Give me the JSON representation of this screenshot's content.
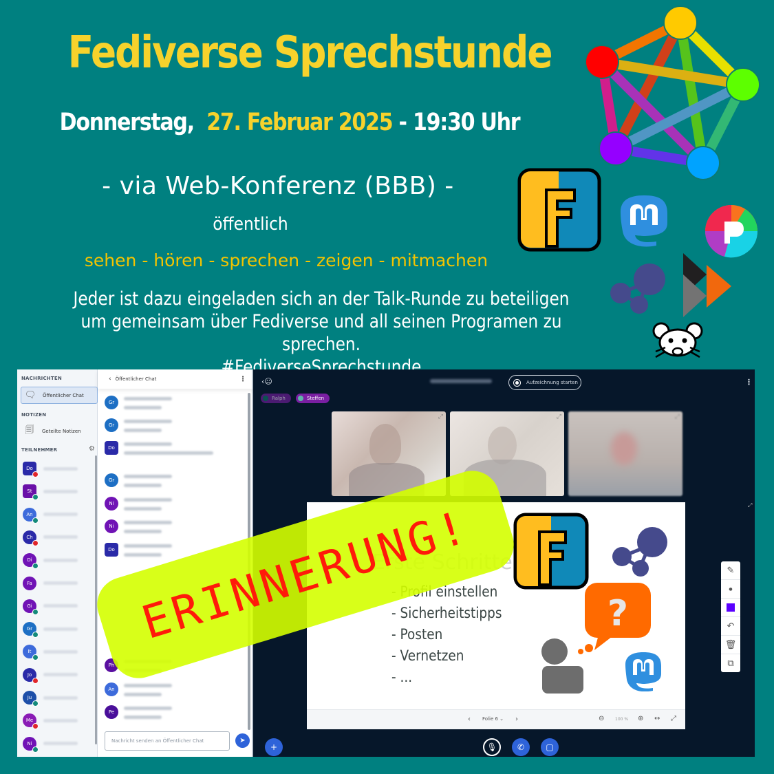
{
  "header": {
    "title": "Fediverse Sprechstunde",
    "date_prefix": "Donnerstag,  ",
    "date": "27. Februar 2025",
    "time_suffix": " - 19:30 Uhr",
    "via": "- via Web-Konferenz  (BBB) -",
    "visibility": "öffentlich",
    "actions": "sehen - hören - sprechen - zeigen - mitmachen",
    "invite_line1": "Jeder ist dazu eingeladen sich an der Talk-Runde zu beteiligen",
    "invite_line2": "um gemeinsam über Fediverse und all seinen Programen  zu sprechen.",
    "hashtag": "#FediverseSprechstunde"
  },
  "colors": {
    "background": "#008080",
    "title_yellow": "#f7d22c",
    "actions_yellow": "#f4c300",
    "sticker_bg": "#d4ff00",
    "sticker_text": "#ff1a0a",
    "bbb_dark": "#06172a",
    "bbb_blue": "#2e63d9"
  },
  "logos": [
    "fediverse-logo",
    "friendica-logo",
    "mastodon-logo",
    "pixelfed-logo",
    "hubzilla-logo",
    "peertube-logo",
    "lemmy-logo"
  ],
  "sticker": {
    "text": "ERINNERUNG!"
  },
  "bbb": {
    "nav": {
      "messages_header": "NACHRICHTEN",
      "public_chat": "Öffentlicher Chat",
      "notes_header": "NOTIZEN",
      "shared_notes": "Geteilte Notizen",
      "participants_header": "TEILNEHMER"
    },
    "participants": [
      {
        "initials": "Do",
        "color": "#2a2aa8",
        "square": true,
        "status": "#e0262b"
      },
      {
        "initials": "St",
        "color": "#6a10a8",
        "square": true,
        "status": "#138a7a"
      },
      {
        "initials": "An",
        "color": "#3d6bdb",
        "square": false,
        "status": "#138a7a"
      },
      {
        "initials": "Ch",
        "color": "#2a2aa8",
        "square": false,
        "status": "#e0262b"
      },
      {
        "initials": "Di",
        "color": "#7013b5",
        "square": false,
        "status": "#138a7a"
      },
      {
        "initials": "Fa",
        "color": "#7013b5",
        "square": false,
        "status": ""
      },
      {
        "initials": "Gi",
        "color": "#7013b5",
        "square": false,
        "status": "#138a7a"
      },
      {
        "initials": "Gr",
        "color": "#1d6fc4",
        "square": false,
        "status": "#138a7a"
      },
      {
        "initials": "It",
        "color": "#3d6bdb",
        "square": false,
        "status": "#138a7a"
      },
      {
        "initials": "Jo",
        "color": "#2a2aa8",
        "square": false,
        "status": "#e0262b"
      },
      {
        "initials": "Ju",
        "color": "#1d4fa8",
        "square": false,
        "status": "#138a7a"
      },
      {
        "initials": "Me",
        "color": "#8a1cb5",
        "square": false,
        "status": "#e0262b"
      },
      {
        "initials": "Ni",
        "color": "#7013b5",
        "square": false,
        "status": "#138a7a"
      }
    ],
    "chat": {
      "title": "Öffentlicher Chat",
      "input_placeholder": "Nachricht senden an Öffentlicher Chat",
      "messages": [
        {
          "initials": "Gr",
          "color": "#1d6fc4",
          "square": false
        },
        {
          "initials": "Gr",
          "color": "#1d6fc4",
          "square": false
        },
        {
          "initials": "Do",
          "color": "#2a2aa8",
          "square": true
        },
        {
          "initials": "Gr",
          "color": "#1d6fc4",
          "square": false
        },
        {
          "initials": "Ni",
          "color": "#7013b5",
          "square": false
        },
        {
          "initials": "Ni",
          "color": "#7013b5",
          "square": false
        },
        {
          "initials": "Do",
          "color": "#2a2aa8",
          "square": true
        },
        {
          "initials": "Ph",
          "color": "#5a0fa0",
          "square": false
        },
        {
          "initials": "An",
          "color": "#3d6bdb",
          "square": false
        },
        {
          "initials": "Pe",
          "color": "#4a0f9a",
          "square": false
        }
      ]
    },
    "record_button": "Aufzeichnung starten",
    "talkers": [
      "Ralph",
      "Steffen"
    ],
    "slide": {
      "title": "Erste Schritte",
      "items": [
        "- Profil einstellen",
        "- Sicherheitstipps",
        "- Posten",
        "- Vernetzen",
        "- ..."
      ],
      "current": "Folie 6",
      "zoom": "100 %"
    }
  }
}
